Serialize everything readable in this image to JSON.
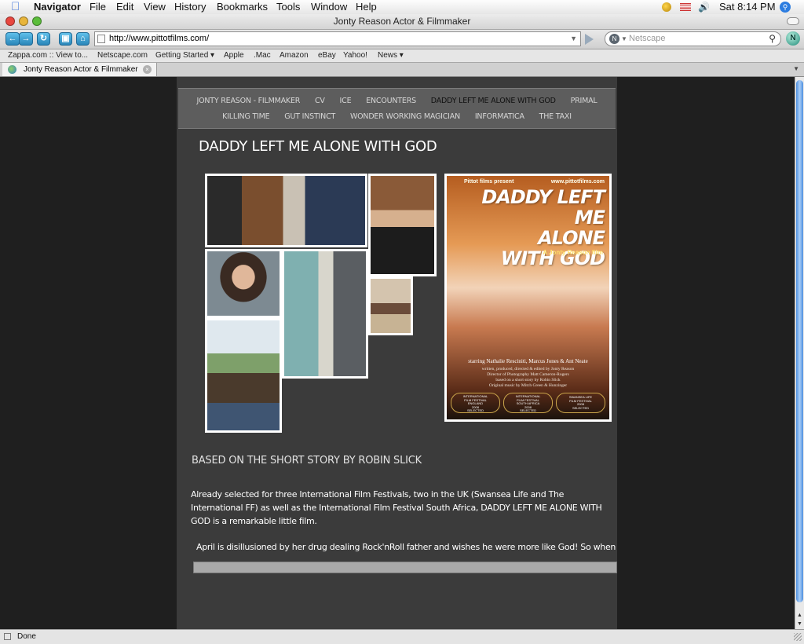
{
  "menubar": {
    "app": "Navigator",
    "items": [
      "File",
      "Edit",
      "View",
      "History",
      "Bookmarks",
      "Tools",
      "Window",
      "Help"
    ],
    "clock": "Sat 8:14 PM"
  },
  "window": {
    "title": "Jonty Reason Actor & Filmmaker"
  },
  "toolbar": {
    "url": "http://www.pittotfilms.com/",
    "search_placeholder": "Netscape"
  },
  "bookmarks": [
    "Zappa.com :: View to...",
    "Netscape.com",
    "Getting Started ▾",
    "Apple",
    ".Mac",
    "Amazon",
    "eBay",
    "Yahoo!",
    "News ▾"
  ],
  "tab": {
    "label": "Jonty Reason Actor & Filmmaker"
  },
  "site": {
    "nav_row1": [
      "JONTY REASON - FILMMAKER",
      "CV",
      "ICE",
      "ENCOUNTERS",
      "DADDY LEFT ME ALONE WITH GOD",
      "PRIMAL"
    ],
    "nav_row2": [
      "KILLING TIME",
      "GUT INSTINCT",
      "WONDER WORKING MAGICIAN",
      "INFORMATICA",
      "THE TAXI"
    ],
    "heading": "DADDY LEFT ME ALONE WITH GOD",
    "poster": {
      "top_left": "Pittot films present",
      "top_right": "www.pittotfilms.com",
      "title_lines": [
        "DADDY LEFT ME",
        "ALONE",
        "WITH GOD"
      ],
      "tagline": "A Jonty Reason film",
      "starring": "starring Nathalie Resciniti, Marcus Jones & Ant Neate",
      "credits": [
        "written, produced, directed & edited by Jonty Reason",
        "Director of Photography Matt Cameron-Rogers",
        "based on a short story by Robin Slick",
        "Original music by Mitch Green & Hunzinger"
      ],
      "laurels": [
        [
          "INTERNATIONAL",
          "FILM FESTIVAL",
          "ENGLAND",
          "2008",
          "SELECTED"
        ],
        [
          "INTERNATIONAL",
          "FILM FESTIVAL",
          "SOUTH AFRICA",
          "2008",
          "SELECTED"
        ],
        [
          "SWANSEA LIFE",
          "FILM FESTIVAL",
          "2008",
          "SELECTED"
        ]
      ]
    },
    "subheading": "BASED ON THE SHORT STORY BY ROBIN SLICK",
    "paragraph": "Already selected for three International Film Festivals, two in the UK (Swansea Life and The International FF) as well as the International Film Festival South Africa, DADDY LEFT ME ALONE WITH GOD is a remarkable little film.",
    "scroller": "April is disillusioned by her drug dealing Rock'nRoll father and wishes he were more like God! So when God"
  },
  "status": "Done"
}
